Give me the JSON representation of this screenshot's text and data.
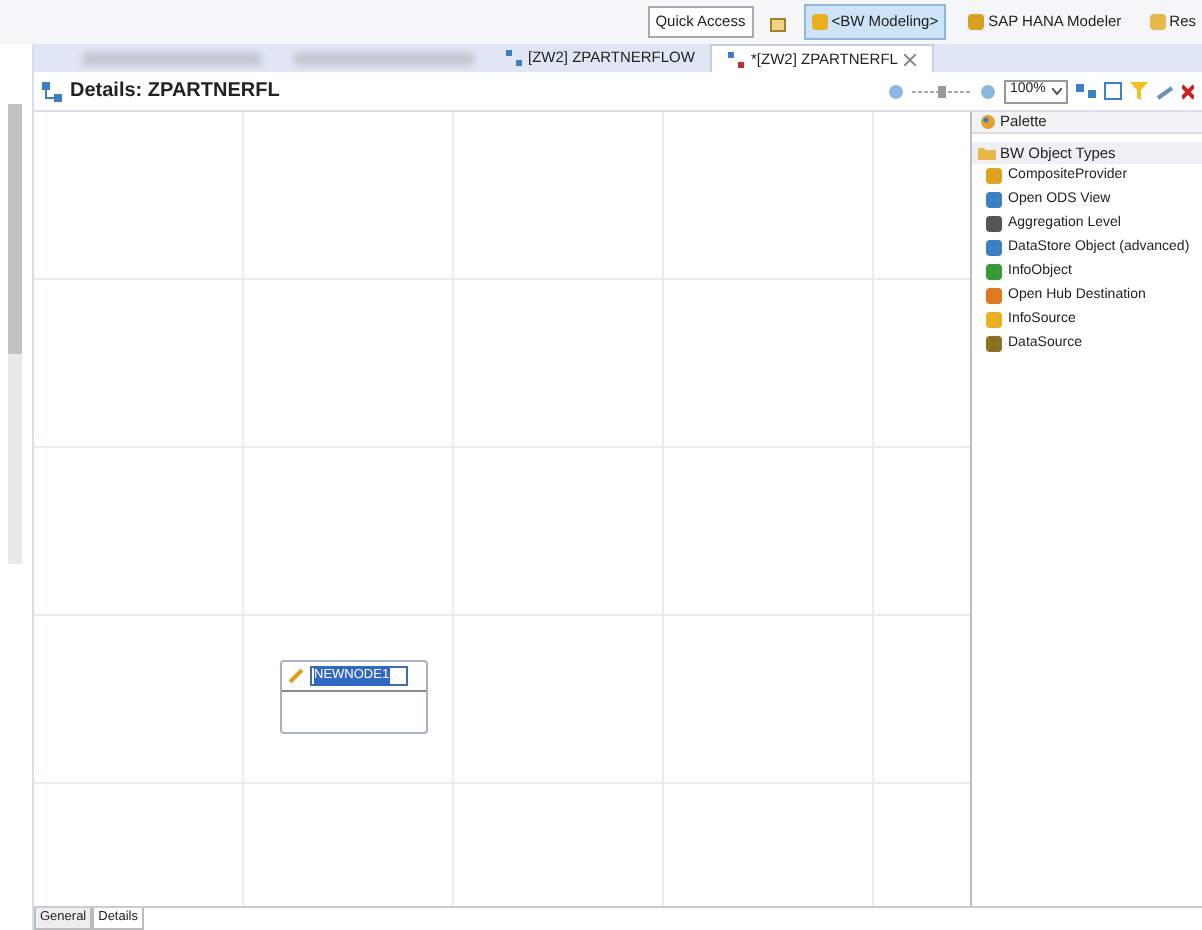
{
  "toolbar": {
    "quick_access": "Quick Access",
    "perspectives": [
      {
        "label": "<BW Modeling>",
        "selected": true
      },
      {
        "label": "SAP HANA Modeler",
        "selected": false
      },
      {
        "label": "Res",
        "selected": false
      }
    ]
  },
  "editor_tabs": [
    {
      "kind": "blurred",
      "selected": false
    },
    {
      "kind": "blurred",
      "selected": false
    },
    {
      "kind": "document",
      "label": "[ZW2] ZPARTNERFLOW",
      "selected": false
    },
    {
      "kind": "document",
      "label": "*[ZW2] ZPARTNERFL",
      "selected": true
    }
  ],
  "details": {
    "title": "Details: ZPARTNERFL",
    "zoom": "100%",
    "zoom_slider": {
      "level": 0.5
    }
  },
  "canvas": {
    "node": {
      "name": "NEWNODE1"
    }
  },
  "palette": {
    "title": "Palette",
    "group": "BW Object Types",
    "items": [
      "CompositeProvider",
      "Open ODS View",
      "Aggregation Level",
      "DataStore Object (advanced)",
      "InfoObject",
      "Open Hub Destination",
      "InfoSource",
      "DataSource"
    ]
  },
  "bottom_tabs": [
    {
      "label": "General",
      "selected": false
    },
    {
      "label": "Details",
      "selected": true
    }
  ]
}
